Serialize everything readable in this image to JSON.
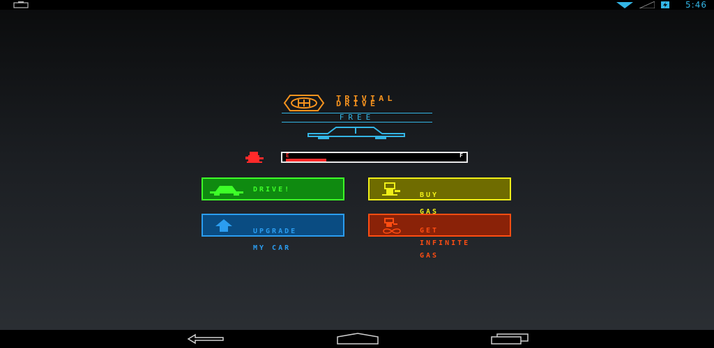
{
  "status_bar": {
    "time": "5:46",
    "left_icon": "briefcase-icon",
    "right_icons": [
      "wifi-icon",
      "signal-icon",
      "battery-charging-icon"
    ]
  },
  "logo": {
    "title_line1": "TRIVIAL",
    "title_line2": "DRIVE",
    "edition": "FREE",
    "icon": "tire-icon"
  },
  "gas_gauge": {
    "empty_label": "E",
    "full_label": "F",
    "level_fraction": 0.23,
    "icon": "gas-pump-icon"
  },
  "buttons": {
    "drive": {
      "label": "DRIVE!",
      "icon": "car-icon"
    },
    "buy_gas": {
      "line1": "BUY",
      "line2": "GAS",
      "icon": "gas-pump-icon"
    },
    "upgrade": {
      "line1": "UPGRADE",
      "line2": "MY CAR",
      "icon": "up-arrow-icon"
    },
    "infinite_gas": {
      "line1": "GET",
      "line2": "INFINITE",
      "line3": "GAS",
      "icon": "infinite-gas-icon"
    }
  },
  "nav_bar": {
    "items": [
      "back-icon",
      "home-icon",
      "recent-apps-icon"
    ]
  },
  "colors": {
    "accent_blue": "#33b5e5",
    "logo_orange": "#f7931e",
    "drive_green": "#3dff28",
    "buy_yellow": "#f0ef18",
    "upgrade_blue": "#2b9df0",
    "infinite_red": "#ff4d12"
  }
}
